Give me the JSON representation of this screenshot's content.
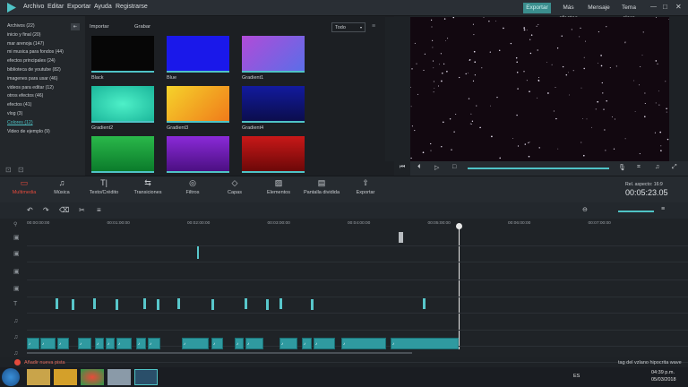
{
  "app": {
    "menu": [
      "Archivo",
      "Editar",
      "Exportar",
      "Ayuda",
      "Registrarse"
    ],
    "buttons": {
      "export": "Exportar",
      "effects": "Más efectos",
      "message": "Mensaje",
      "theme": "Tema claro"
    }
  },
  "library": {
    "items": [
      "Archivos (22)",
      "inicio y final (20)",
      "mar arenoja (147)",
      "mi musica para fondos (44)",
      "efectos principales (24)",
      "biblioteca de youtube (82)",
      "imagenes para usar (46)",
      "videos para editar (12)",
      "otros efectos (46)",
      "efectos (41)",
      "vlog (3)",
      "Colores (12)",
      "Video de ejemplo (9)"
    ],
    "selected_index": 11,
    "import_label": "Importar",
    "record_label": "Grabar",
    "filter_value": "Todo"
  },
  "thumbnails": [
    {
      "label": "Black",
      "color": "#060606"
    },
    {
      "label": "Blue",
      "color": "#1a18ea"
    },
    {
      "label": "Gradient1",
      "color": "#8a56d8"
    },
    {
      "label": "Gradient2",
      "color": "#28d8b8"
    },
    {
      "label": "Gradient3",
      "color": "#f2a52b"
    },
    {
      "label": "Gradient4",
      "color": "#111a86"
    },
    {
      "label": "",
      "color": "#11a235"
    },
    {
      "label": "",
      "color": "#6b1fb0"
    },
    {
      "label": "",
      "color": "#a80f0f"
    }
  ],
  "toolbar": {
    "tools": [
      {
        "label": "Multimedia",
        "icon": "folder-icon",
        "active": true
      },
      {
        "label": "Música",
        "icon": "music-note-icon"
      },
      {
        "label": "Texto/Crédito",
        "icon": "text-icon"
      },
      {
        "label": "Transiciones",
        "icon": "transition-icon"
      },
      {
        "label": "Filtros",
        "icon": "filter-icon"
      },
      {
        "label": "Capas",
        "icon": "layers-icon"
      },
      {
        "label": "Elementos",
        "icon": "image-icon"
      },
      {
        "label": "Pantalla dividida",
        "icon": "split-screen-icon"
      },
      {
        "label": "Exportar",
        "icon": "export-icon"
      }
    ],
    "aspect_label": "Rel. aspecto: 16:9",
    "time_display": "00:05:23.05"
  },
  "timeline": {
    "ruler": [
      "00:00:00:00",
      "00:01:00:00",
      "00:02:00:00",
      "00:03:00:00",
      "00:04:00:00",
      "00:05:00:00",
      "00:06:00:00",
      "00:07:00:00"
    ],
    "add_track_label": "Añadir nueva pista",
    "audio_clips": [
      "AUDIO",
      "♪ Avanzando",
      "♪ Avanzando",
      "♪ Avanzando",
      "♪ Avanzando",
      "♪ Avanzando",
      "♪ Avanzando",
      "♪ Avanzando",
      "♪ Avanzando",
      "♪ Avanzando",
      "♪ Avanzando",
      "♪ Avanzando",
      "♪ Avanzando",
      "♪ Avanzando",
      "♪ Avanzando"
    ],
    "footer_text": "tag del vzlano hipocrita wave"
  },
  "taskbar": {
    "lang": "ES",
    "time": "04:39 p.m.",
    "date": "05/03/2018"
  },
  "colors": {
    "accent": "#4fc3c6",
    "active_tool": "#e34a3c"
  }
}
